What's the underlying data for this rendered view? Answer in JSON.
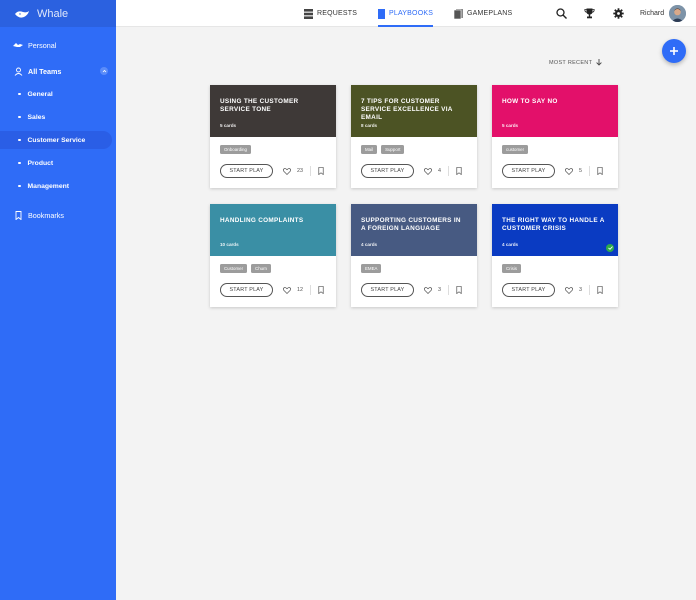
{
  "app": {
    "name": "Whale"
  },
  "sidebar": {
    "items": [
      {
        "label": "Personal",
        "icon": "whale-icon"
      },
      {
        "label": "All Teams",
        "icon": "team-icon"
      },
      {
        "label": "Bookmarks",
        "icon": "bookmark-icon"
      }
    ],
    "teams": [
      {
        "label": "General",
        "active": false
      },
      {
        "label": "Sales",
        "active": false
      },
      {
        "label": "Customer Service",
        "active": true
      },
      {
        "label": "Product",
        "active": false
      },
      {
        "label": "Management",
        "active": false
      }
    ]
  },
  "topbar": {
    "tabs": [
      {
        "label": "REQUESTS",
        "active": false
      },
      {
        "label": "PLAYBOOKS",
        "active": true
      },
      {
        "label": "GAMEPLANS",
        "active": false
      }
    ],
    "user": {
      "name": "Richard"
    }
  },
  "sort": {
    "label": "MOST RECENT"
  },
  "colors": {
    "accent": "#2f6cf7",
    "success": "#2eaa4a"
  },
  "cards": [
    {
      "title": "USING THE CUSTOMER SERVICE TONE",
      "count": "5 cards",
      "color": "#3e3937",
      "tags": [
        "Onboarding"
      ],
      "button": "START PLAY",
      "likes": "23",
      "checked": false
    },
    {
      "title": "7 TIPS FOR CUSTOMER SERVICE EXCELLENCE VIA EMAIL",
      "count": "8 cards",
      "color": "#4c5324",
      "tags": [
        "Mail",
        "Support"
      ],
      "button": "START PLAY",
      "likes": "4",
      "checked": false
    },
    {
      "title": "HOW TO SAY NO",
      "count": "5 cards",
      "color": "#e3106a",
      "tags": [
        "customer"
      ],
      "button": "START PLAY",
      "likes": "5",
      "checked": false
    },
    {
      "title": "HANDLING COMPLAINTS",
      "count": "10 cards",
      "color": "#3a8fa5",
      "tags": [
        "Customer",
        "Churn"
      ],
      "button": "START PLAY",
      "likes": "12",
      "checked": false
    },
    {
      "title": "SUPPORTING CUSTOMERS IN A FOREIGN LANGUAGE",
      "count": "4 cards",
      "color": "#475a82",
      "tags": [
        "EMEA"
      ],
      "button": "START PLAY",
      "likes": "3",
      "checked": false
    },
    {
      "title": "THE RIGHT WAY TO HANDLE A CUSTOMER CRISIS",
      "count": "4 cards",
      "color": "#0a3bc2",
      "tags": [
        "Crisis"
      ],
      "button": "START PLAY",
      "likes": "3",
      "checked": true
    }
  ]
}
